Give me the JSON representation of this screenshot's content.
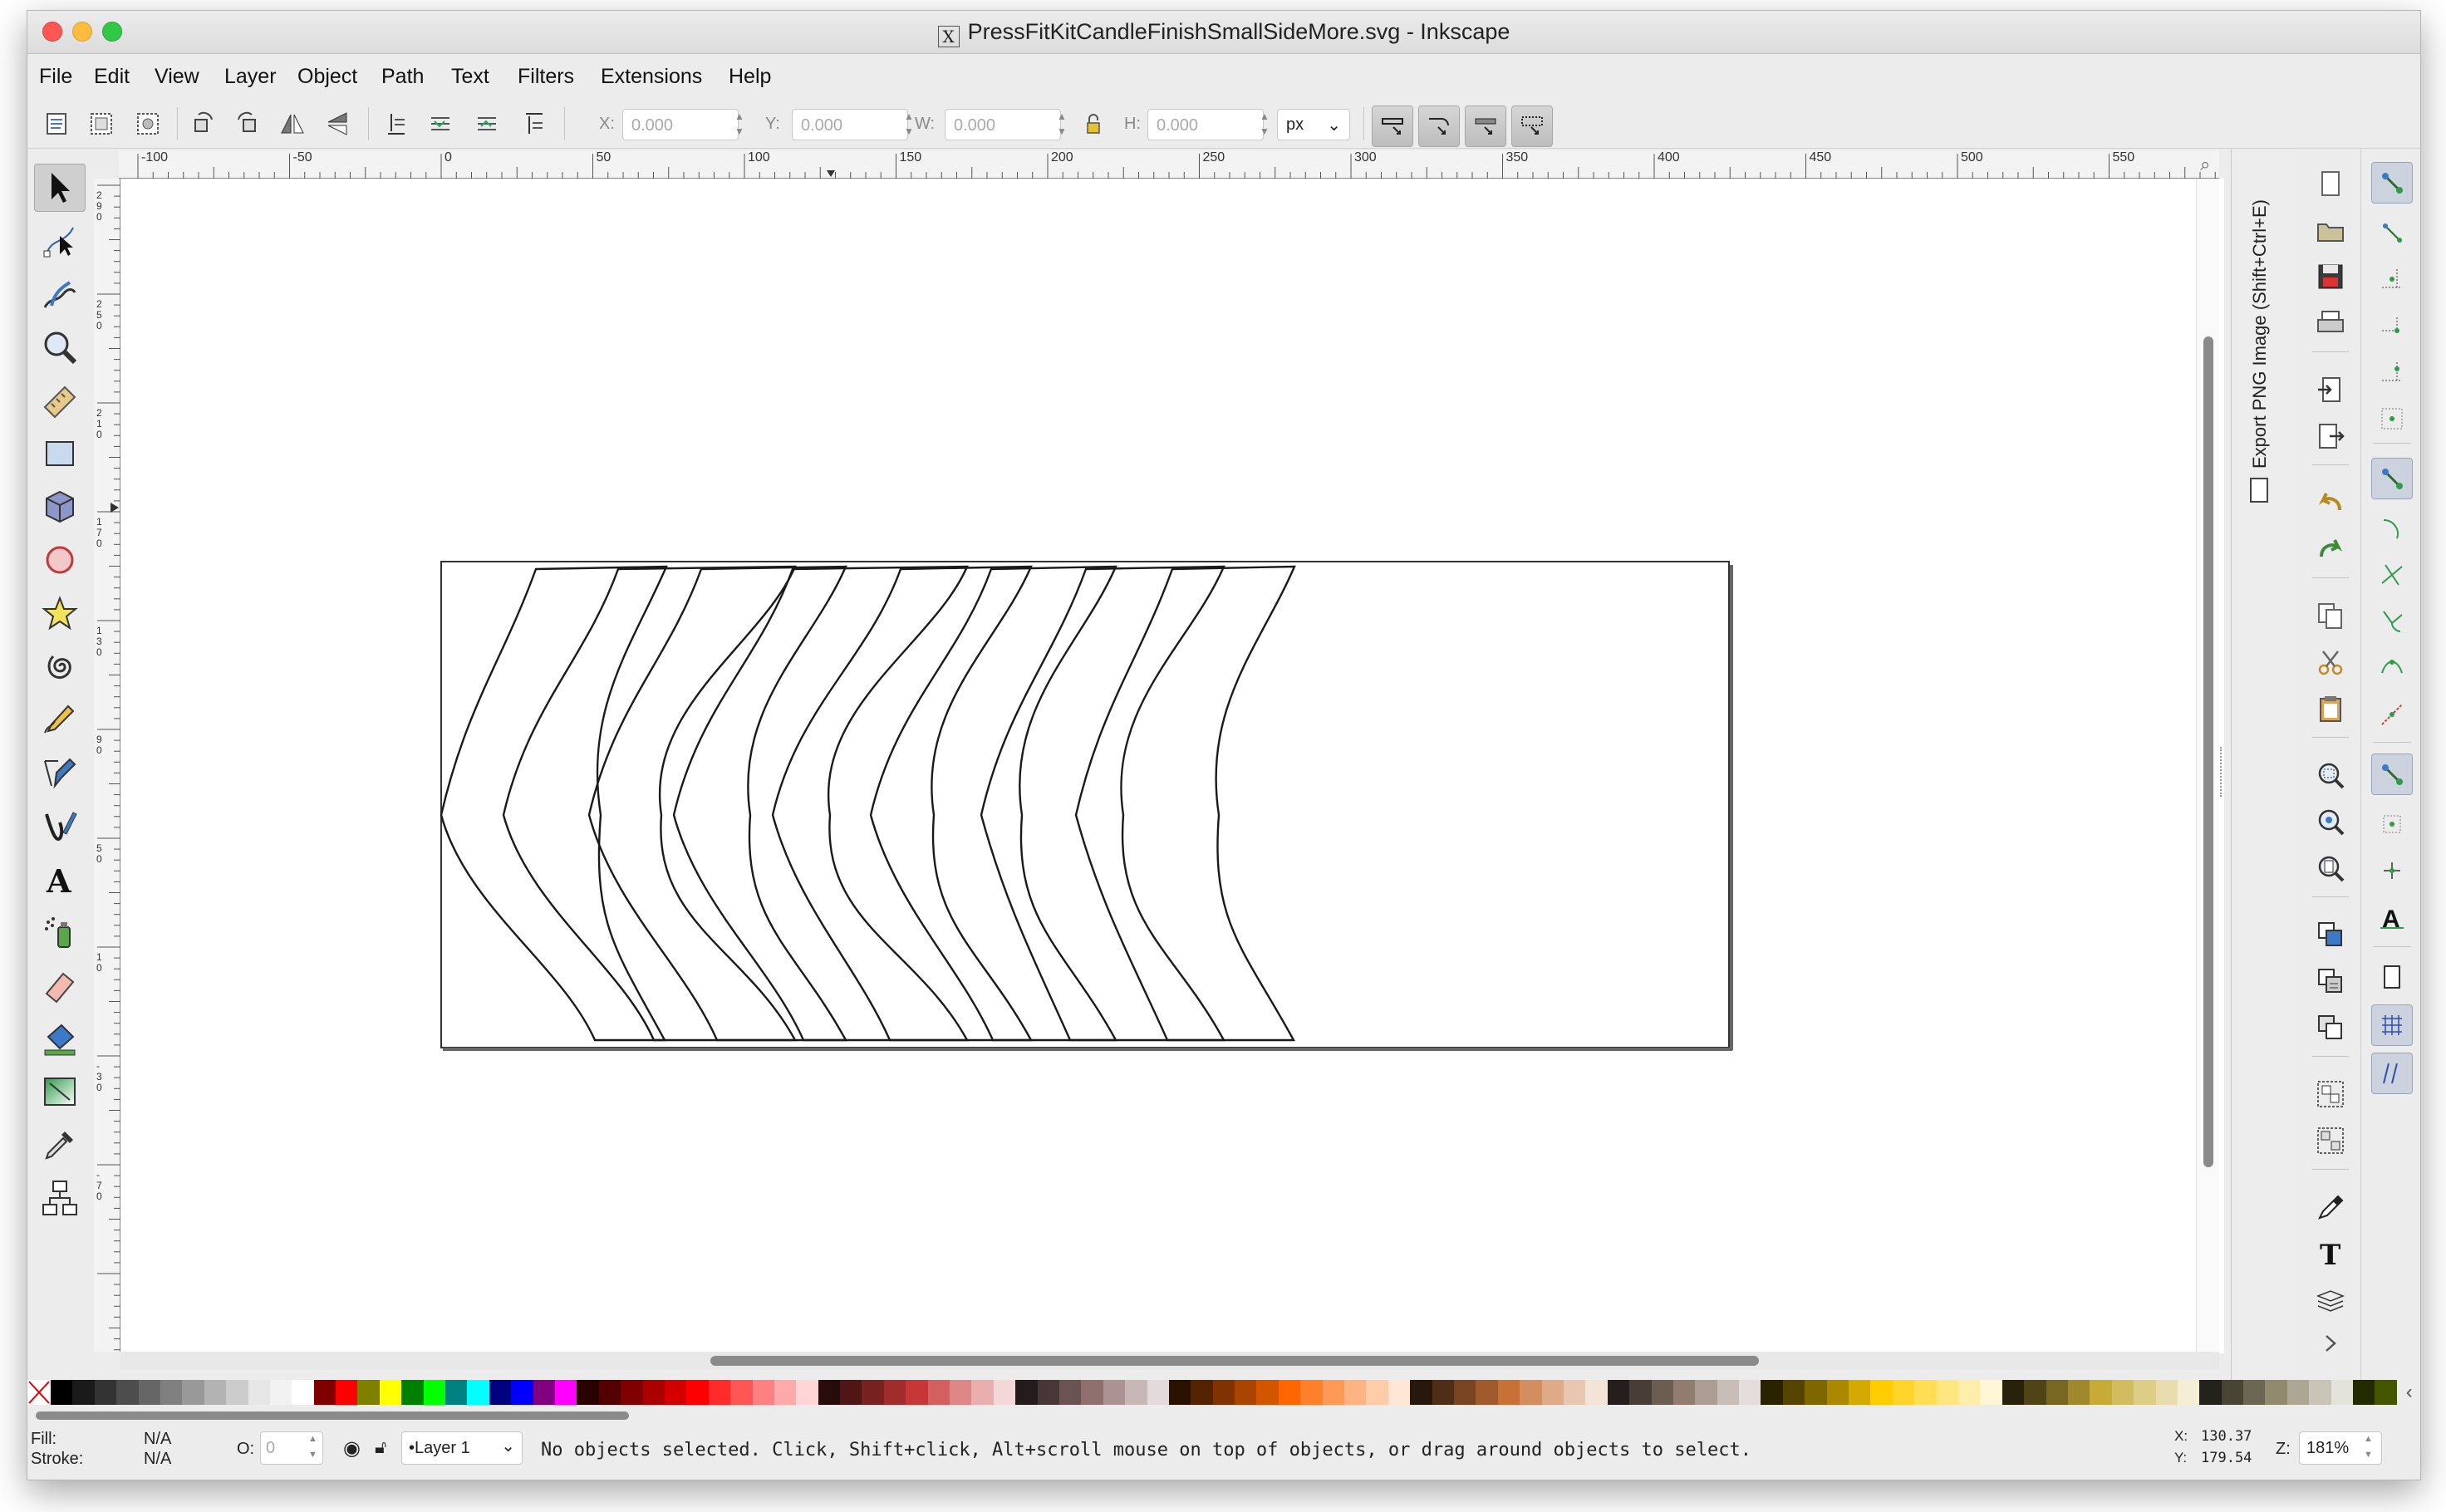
{
  "window": {
    "title": "PressFitKitCandleFinishSmallSideMore.svg - Inkscape",
    "title_icon": "X",
    "traffic_lights": {
      "close": "#fc5753",
      "minimize": "#fdbc40",
      "zoom": "#33c748"
    }
  },
  "menu": [
    "File",
    "Edit",
    "View",
    "Layer",
    "Object",
    "Path",
    "Text",
    "Filters",
    "Extensions",
    "Help"
  ],
  "controls": {
    "x_label": "X:",
    "x_value": "0.000",
    "y_label": "Y:",
    "y_value": "0.000",
    "w_label": "W:",
    "w_value": "0.000",
    "h_label": "H:",
    "h_value": "0.000",
    "unit": "px"
  },
  "ruler_top_labels": [
    "-100",
    "-50",
    "0",
    "50",
    "100",
    "150",
    "200",
    "250",
    "300",
    "350",
    "400",
    "450",
    "500",
    "550"
  ],
  "ruler_left_labels": [
    "2\n9\n0",
    "2\n5\n0",
    "2\n1\n0",
    "1\n7\n0",
    "1\n3\n0",
    "9\n0",
    "5\n0",
    "1\n0",
    "-\n3\n0",
    "-\n7\n0"
  ],
  "tools": [
    "selector-tool",
    "node-tool",
    "tweak-tool",
    "zoom-tool",
    "measure-tool",
    "rectangle-tool",
    "3d-box-tool",
    "ellipse-tool",
    "star-tool",
    "spiral-tool",
    "pencil-tool",
    "pen-tool",
    "calligraphy-tool",
    "text-tool",
    "spray-tool",
    "eraser-tool",
    "paint-bucket-tool",
    "gradient-tool",
    "dropper-tool",
    "connector-tool"
  ],
  "export_panel": {
    "label": "Export PNG Image (Shift+Ctrl+E)"
  },
  "palette_colors": [
    "#000000",
    "#1a1a1a",
    "#333333",
    "#4d4d4d",
    "#666666",
    "#808080",
    "#999999",
    "#b3b3b3",
    "#cccccc",
    "#e6e6e6",
    "#f2f2f2",
    "#ffffff",
    "#800000",
    "#ff0000",
    "#808000",
    "#ffff00",
    "#008000",
    "#00ff00",
    "#008080",
    "#00ffff",
    "#000080",
    "#0000ff",
    "#800080",
    "#ff00ff",
    "#2b0000",
    "#550000",
    "#800000",
    "#aa0000",
    "#d40000",
    "#ff0000",
    "#ff2a2a",
    "#ff5555",
    "#ff8080",
    "#ffaaaa",
    "#ffd5d5",
    "#280b0b",
    "#501616",
    "#782121",
    "#a02c2c",
    "#c83737",
    "#d35f5f",
    "#de8787",
    "#e9afaf",
    "#f4d7d7",
    "#241c1c",
    "#483737",
    "#6c5353",
    "#916f6f",
    "#ac9393",
    "#c8b7b7",
    "#e3dbdb",
    "#2b1100",
    "#552200",
    "#803300",
    "#aa4400",
    "#d45500",
    "#ff6600",
    "#ff7f2a",
    "#ff9955",
    "#ffb380",
    "#ffccaa",
    "#ffe6d5",
    "#28170b",
    "#502d16",
    "#784421",
    "#a05a2c",
    "#c87137",
    "#d38d5f",
    "#deaa87",
    "#e9c6af",
    "#f4e3d7",
    "#241f1c",
    "#483e37",
    "#6c5d53",
    "#917c6f",
    "#ac9d93",
    "#c8beb7",
    "#e3dedb",
    "#2b2200",
    "#554400",
    "#806600",
    "#aa8800",
    "#d4aa00",
    "#ffcc00",
    "#ffd42a",
    "#ffdd55",
    "#ffe680",
    "#ffeeaa",
    "#fff6d5",
    "#28220b",
    "#504416",
    "#786721",
    "#a0892c",
    "#c8ab37",
    "#d3bc5f",
    "#decd87",
    "#e9ddaf",
    "#f4eed7",
    "#24221c",
    "#484537",
    "#6c6753",
    "#918a6f",
    "#aca793",
    "#c8c4b7",
    "#e3e2db",
    "#222b00",
    "#445500"
  ],
  "status": {
    "fill_label": "Fill:",
    "fill_value": "N/A",
    "stroke_label": "Stroke:",
    "stroke_value": "N/A",
    "opacity_label": "O:",
    "opacity_value": "0",
    "layer": "•Layer 1",
    "message": "No objects selected. Click, Shift+click, Alt+scroll mouse on top of objects, or drag around objects to select.",
    "x_label": "X:",
    "x_value": "130.37",
    "y_label": "Y:",
    "y_value": "179.54",
    "zoom_label": "Z:",
    "zoom_value": "181%"
  }
}
